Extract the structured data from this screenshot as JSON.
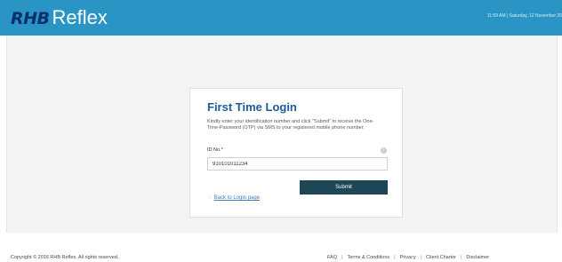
{
  "header": {
    "logo_mark": "RHB",
    "logo_text": "Reflex",
    "datetime": "11:59 AM | Saturday, 12 November 20"
  },
  "card": {
    "title": "First Time Login",
    "description": "Kindly enter your identification number and click \"Submit\" to receive the One-Time-Password (OTP) via SMS to your registered mobile phone number.",
    "id_label": "ID No.*",
    "info_icon": "i",
    "id_value": "910101011234",
    "submit_label": "Submit",
    "back_icon": "›",
    "back_link": "Back to Login page"
  },
  "footer": {
    "copyright": "Copyright © 2016 RHB Reflex. All rights reserved.",
    "links": [
      "FAQ",
      "Terms & Conditions",
      "Privacy",
      "Client Charter",
      "Disclaimer"
    ],
    "separator": "|"
  },
  "colors": {
    "header_bg": "#2a95c5",
    "title": "#1c5a9e",
    "submit_bg": "#1d4657",
    "link": "#3e7fb8"
  }
}
